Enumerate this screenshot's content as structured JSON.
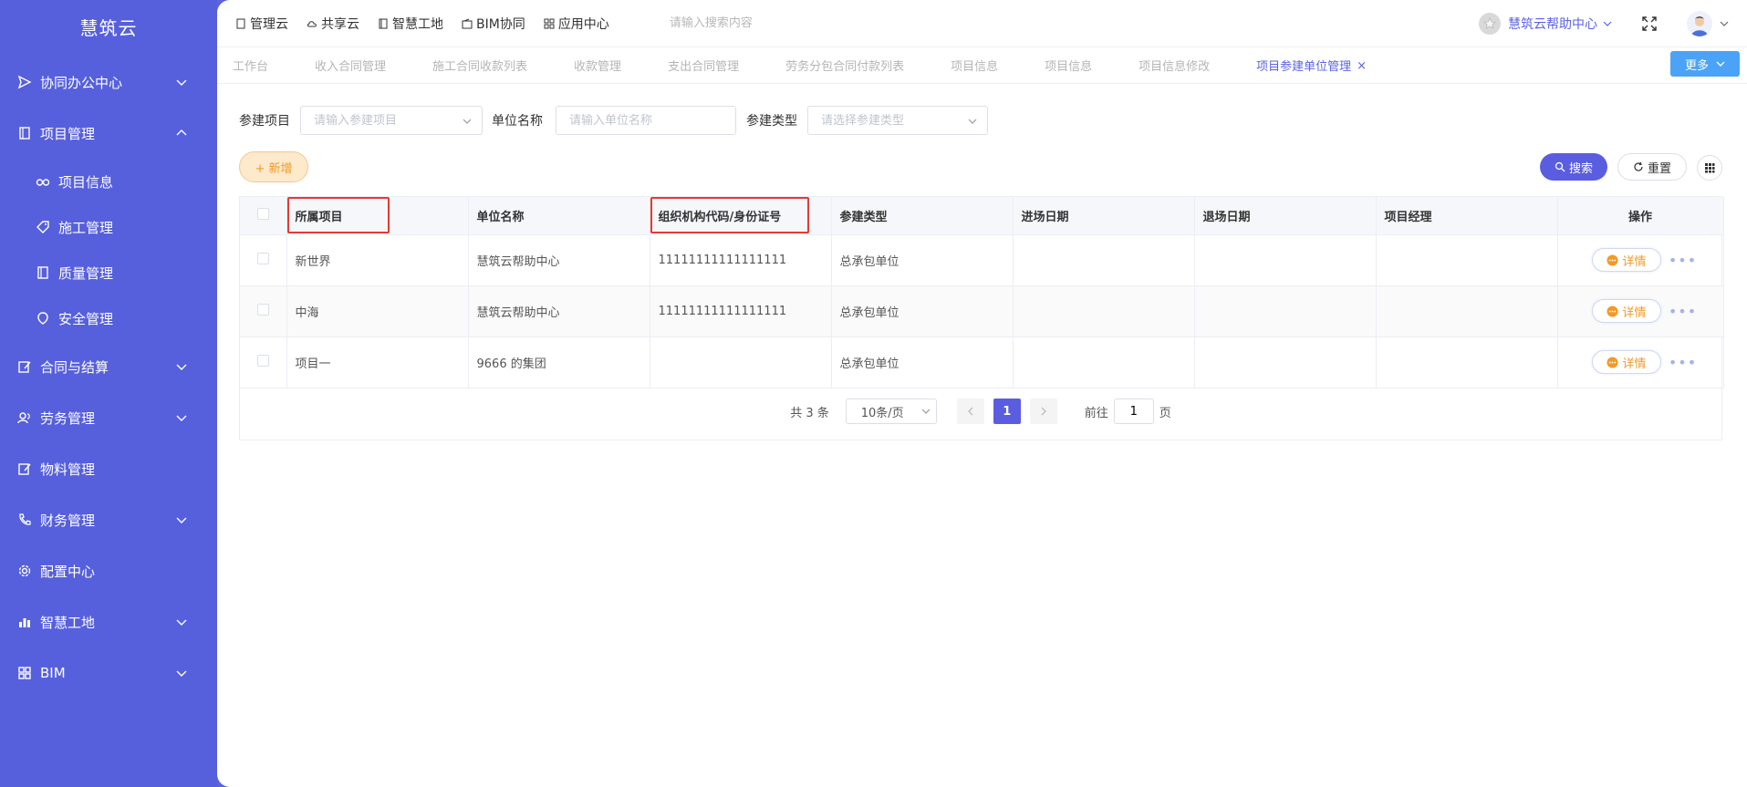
{
  "app": {
    "logo": "慧筑云"
  },
  "sidebar": {
    "items": [
      {
        "label": "协同办公中心",
        "icon": "send-icon",
        "expandable": true,
        "expanded": false
      },
      {
        "label": "项目管理",
        "icon": "book-icon",
        "expandable": true,
        "expanded": true,
        "children": [
          {
            "label": "项目信息",
            "icon": "glasses-icon"
          },
          {
            "label": "施工管理",
            "icon": "tag-icon"
          },
          {
            "label": "质量管理",
            "icon": "book-icon"
          },
          {
            "label": "安全管理",
            "icon": "shield-icon"
          }
        ]
      },
      {
        "label": "合同与结算",
        "icon": "edit-icon",
        "expandable": true
      },
      {
        "label": "劳务管理",
        "icon": "users-icon",
        "expandable": true
      },
      {
        "label": "物料管理",
        "icon": "edit-icon",
        "expandable": false
      },
      {
        "label": "财务管理",
        "icon": "phone-icon",
        "expandable": true
      },
      {
        "label": "配置中心",
        "icon": "gear-icon",
        "expandable": false
      },
      {
        "label": "智慧工地",
        "icon": "bar-chart-icon",
        "expandable": true
      },
      {
        "label": "BIM",
        "icon": "grid-icon",
        "expandable": true
      }
    ]
  },
  "topnav": {
    "items": [
      "管理云",
      "共享云",
      "智慧工地",
      "BIM协同",
      "应用中心"
    ],
    "search_placeholder": "请输入搜索内容",
    "help_label": "慧筑云帮助中心"
  },
  "tabs": {
    "items": [
      "工作台",
      "收入合同管理",
      "施工合同收款列表",
      "收款管理",
      "支出合同管理",
      "劳务分包合同付款列表",
      "项目信息",
      "项目信息",
      "项目信息修改"
    ],
    "active": "项目参建单位管理",
    "close": "×",
    "more": "更多"
  },
  "filters": {
    "project_label": "参建项目",
    "project_placeholder": "请输入参建项目",
    "unit_label": "单位名称",
    "unit_placeholder": "请输入单位名称",
    "type_label": "参建类型",
    "type_placeholder": "请选择参建类型"
  },
  "buttons": {
    "add": "+ 新增",
    "search": "搜索",
    "reset": "重置"
  },
  "table": {
    "headers": [
      "所属项目",
      "单位名称",
      "组织机构代码/身份证号",
      "参建类型",
      "进场日期",
      "退场日期",
      "项目经理",
      "操作"
    ],
    "rows": [
      [
        "新世界",
        "慧筑云帮助中心",
        "11111111111111111",
        "总承包单位",
        "",
        "",
        ""
      ],
      [
        "中海",
        "慧筑云帮助中心",
        "11111111111111111",
        "总承包单位",
        "",
        "",
        ""
      ],
      [
        "项目一",
        "9666 的集团",
        "",
        "总承包单位",
        "",
        "",
        ""
      ]
    ],
    "detail_label": "详情",
    "more_dots": "•••"
  },
  "pagination": {
    "total": "共 3 条",
    "page_size": "10条/页",
    "current_page": "1",
    "goto_label": "前往",
    "goto_value": "1",
    "page_suffix": "页"
  }
}
